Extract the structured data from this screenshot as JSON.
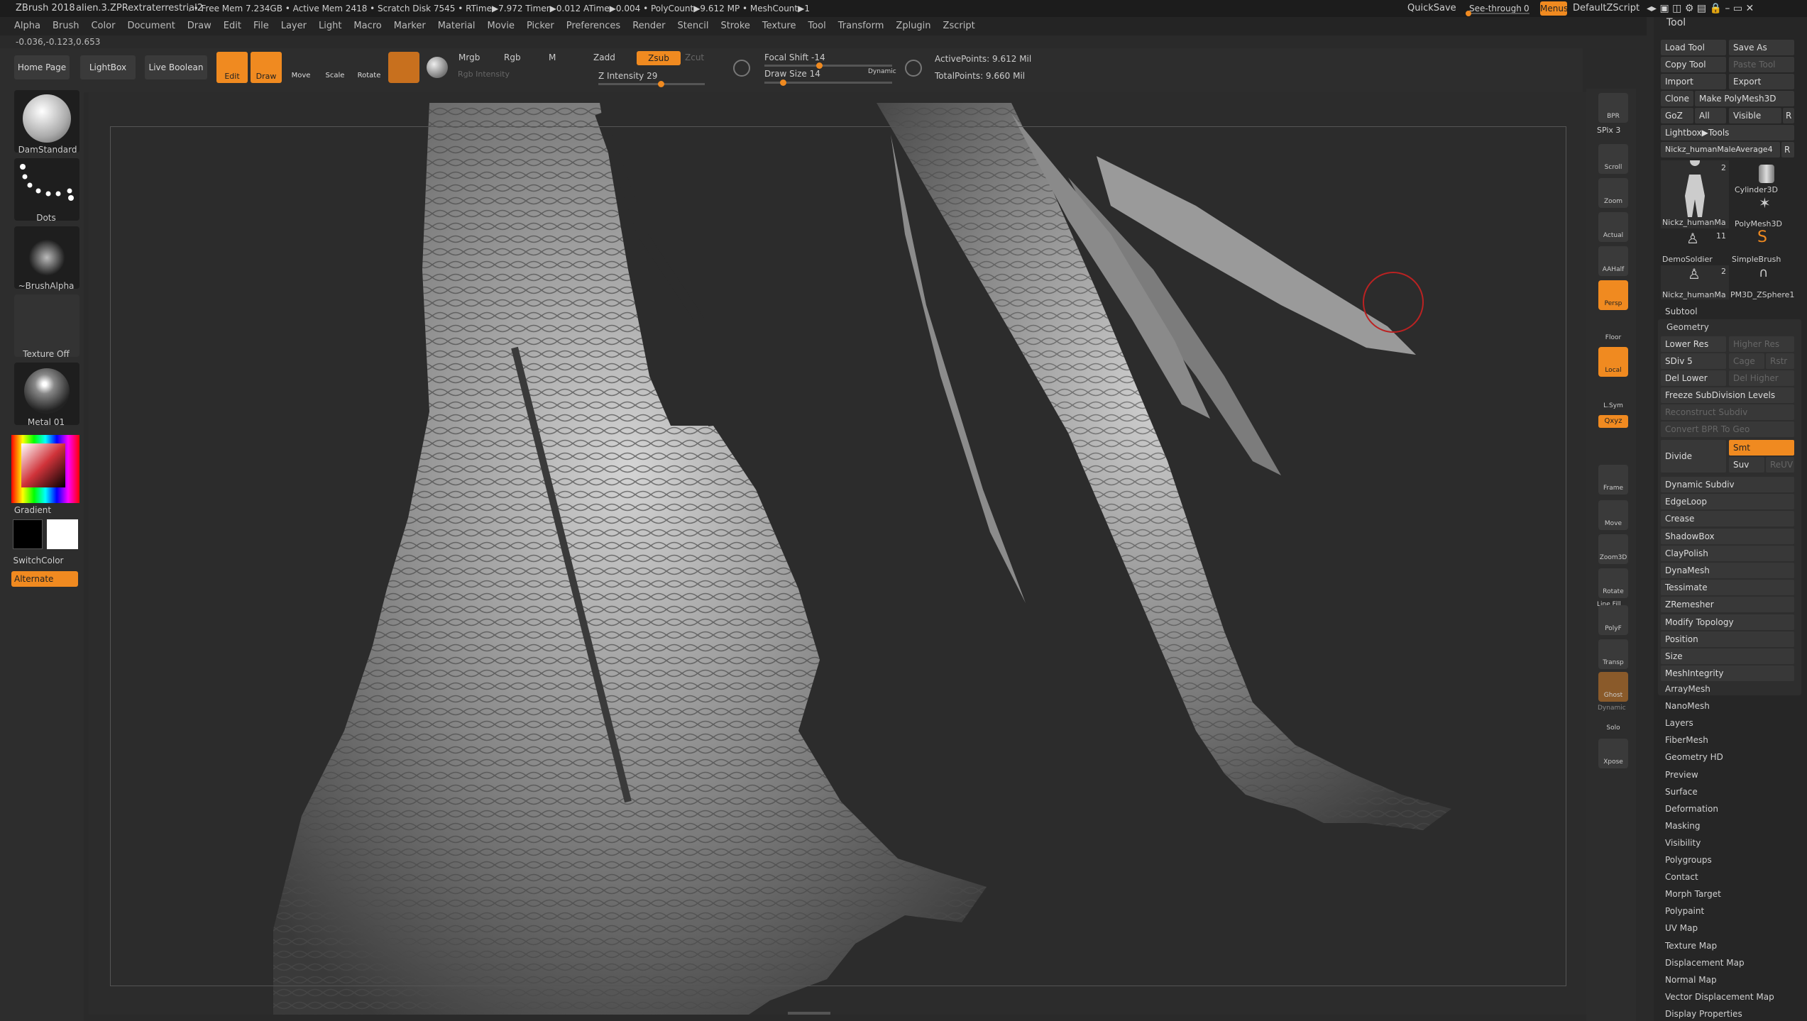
{
  "titlebar": {
    "app": "ZBrush 2018",
    "doc": "alien.3.ZPRextraterrestrial2",
    "stats": ". • Free Mem 7.234GB • Active Mem 2418 • Scratch Disk 7545 • RTime▶7.972 Timer▶0.012 ATime▶0.004 • PolyCount▶9.612 MP • MeshCount▶1",
    "quicksave": "QuickSave",
    "seethrough": "See-through",
    "seethrough_val": "0",
    "menus": "Menus",
    "script": "DefaultZScript"
  },
  "menubar": [
    "Alpha",
    "Brush",
    "Color",
    "Document",
    "Draw",
    "Edit",
    "File",
    "Layer",
    "Light",
    "Macro",
    "Marker",
    "Material",
    "Movie",
    "Picker",
    "Preferences",
    "Render",
    "Stencil",
    "Stroke",
    "Texture",
    "Tool",
    "Transform",
    "Zplugin",
    "Zscript"
  ],
  "coords": "-0.036,-0.123,0.653",
  "shelf": {
    "home": "Home Page",
    "lightbox": "LightBox",
    "liveboolean": "Live Boolean",
    "edit": "Edit",
    "draw": "Draw",
    "move": "Move",
    "scale": "Scale",
    "rotate": "Rotate",
    "mrgb": "Mrgb",
    "rgb": "Rgb",
    "m": "M",
    "rgb_intensity": "Rgb Intensity",
    "zadd": "Zadd",
    "zsub": "Zsub",
    "zcut": "Zcut",
    "z_intensity": "Z Intensity 29",
    "focal": "Focal Shift -14",
    "drawsize": "Draw Size 14",
    "dynamic": "Dynamic",
    "active_points": "ActivePoints: 9.612 Mil",
    "total_points": "TotalPoints: 9.660 Mil",
    "z_intensity_value": 0.29
  },
  "left": {
    "brush": "DamStandard",
    "stroke": "Dots",
    "alpha": "~BrushAlpha",
    "texture": "Texture Off",
    "material": "Metal 01",
    "gradient": "Gradient",
    "switch": "SwitchColor",
    "alternate": "Alternate"
  },
  "right": {
    "bpr": "BPR",
    "spix": "SPix 3",
    "scroll": "Scroll",
    "zoom": "Zoom",
    "actual": "Actual",
    "aahalf": "AAHalf",
    "persp": "Persp",
    "floor": "Floor",
    "local": "Local",
    "lsym": "L.Sym",
    "xyz": "Qxyz",
    "frame": "Frame",
    "move": "Move",
    "zoom3d": "Zoom3D",
    "rotate": "Rotate",
    "linefill": "Line Fill",
    "polyf": "PolyF",
    "transp": "Transp",
    "ghost": "Ghost",
    "dynamic": "Dynamic",
    "solo": "Solo",
    "xpose": "Xpose"
  },
  "tool": {
    "title": "Tool",
    "load": "Load Tool",
    "saveas": "Save As",
    "copy": "Copy Tool",
    "paste": "Paste Tool",
    "import": "Import",
    "export": "Export",
    "clone": "Clone",
    "makepoly": "Make PolyMesh3D",
    "goz": "GoZ",
    "all": "All",
    "visible": "Visible",
    "r": "R",
    "lightbox_tools": "Lightbox▶Tools",
    "current": "Nickz_humanMaleAverage4",
    "r2": "R",
    "thumbs": [
      {
        "label": "Nickz_humanMa",
        "count": "2"
      },
      {
        "label": "Cylinder3D",
        "count": ""
      },
      {
        "label": "PolyMesh3D",
        "count": ""
      },
      {
        "label": "DemoSoldier",
        "count": "11"
      },
      {
        "label": "SimpleBrush",
        "count": ""
      },
      {
        "label": "Nickz_humanMa",
        "count": "2"
      },
      {
        "label": "PM3D_ZSphere1",
        "count": ""
      }
    ],
    "subtool": "Subtool",
    "geometry": "Geometry",
    "lowerres": "Lower Res",
    "higherres": "Higher Res",
    "sdiv": "SDiv 5",
    "cage": "Cage",
    "rstr": "Rstr",
    "dellower": "Del Lower",
    "delhigher": "Del Higher",
    "freeze": "Freeze SubDivision Levels",
    "reconstruct": "Reconstruct Subdiv",
    "convert": "Convert BPR To Geo",
    "divide": "Divide",
    "smt": "Smt",
    "suv": "Suv",
    "reuv": "ReUV",
    "geo_items": [
      "Dynamic Subdiv",
      "EdgeLoop",
      "Crease",
      "ShadowBox",
      "ClayPolish",
      "DynaMesh",
      "Tessimate",
      "ZRemesher",
      "Modify Topology",
      "Position",
      "Size",
      "MeshIntegrity"
    ],
    "sections": [
      "ArrayMesh",
      "NanoMesh",
      "Layers",
      "FiberMesh",
      "Geometry HD",
      "Preview",
      "Surface",
      "Deformation",
      "Masking",
      "Visibility",
      "Polygroups",
      "Contact",
      "Morph Target",
      "Polypaint",
      "UV Map",
      "Texture Map",
      "Displacement Map",
      "Normal Map",
      "Vector Displacement Map",
      "Display Properties"
    ]
  }
}
